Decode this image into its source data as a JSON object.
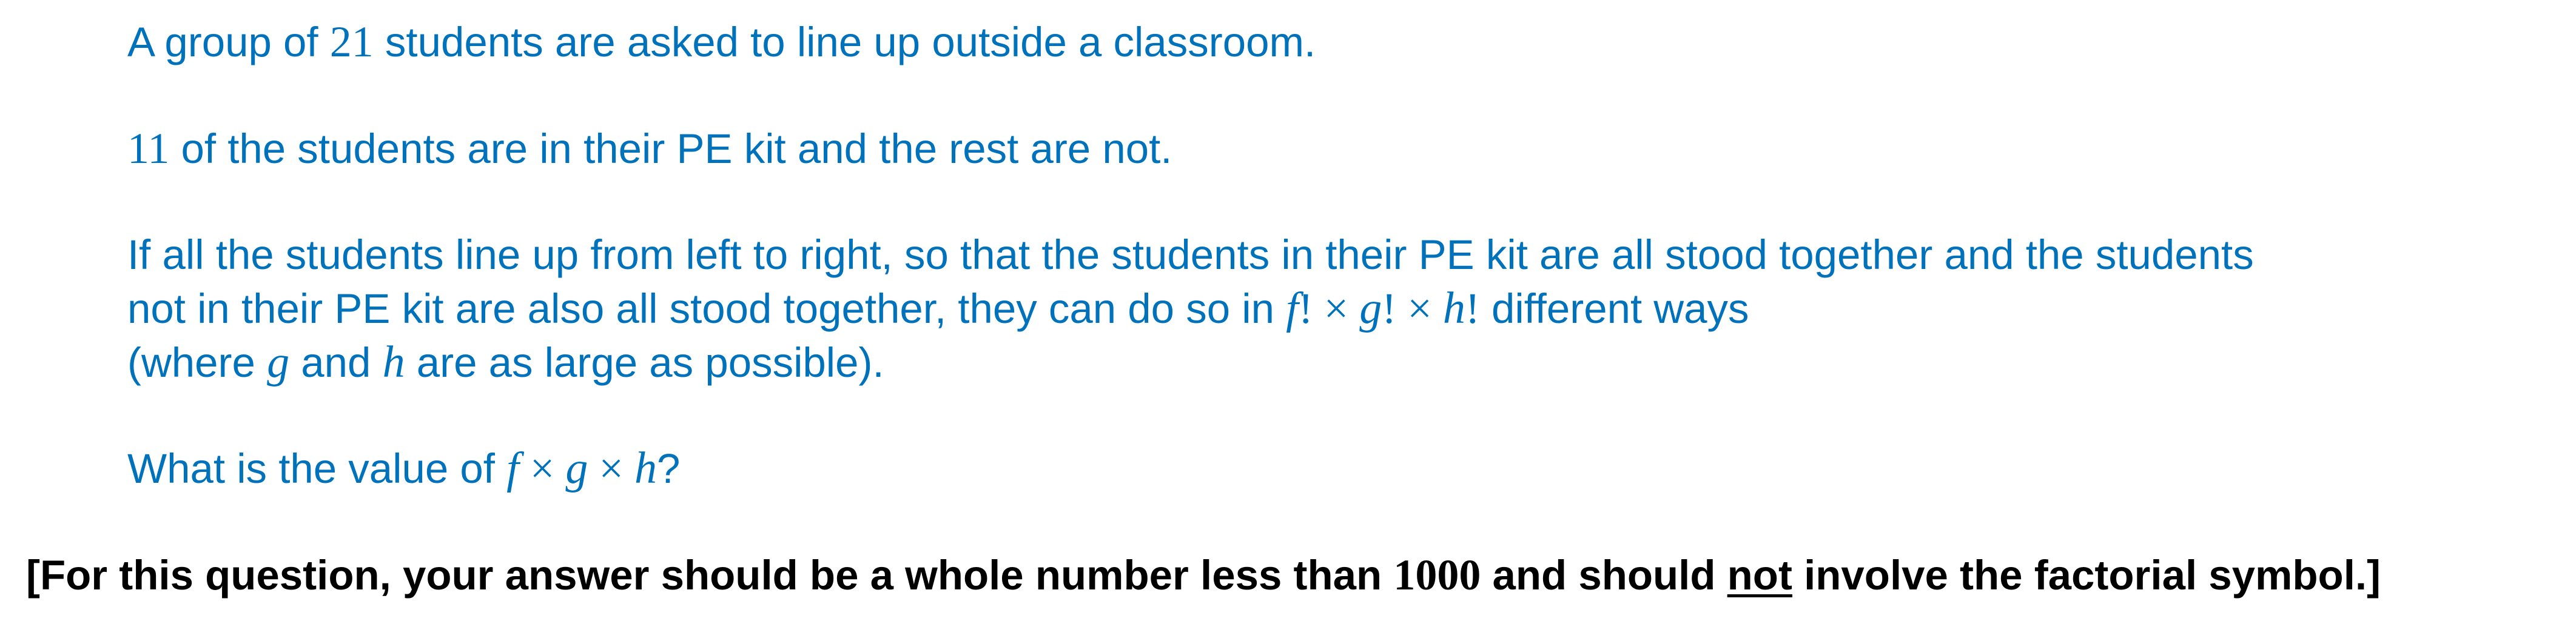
{
  "question": {
    "p1": {
      "a": "A group of ",
      "n": "21",
      "b": " students are asked to line up outside a classroom."
    },
    "p2": {
      "n": "11",
      "b": " of the students are in their PE kit and the rest are not."
    },
    "p3": {
      "line1": "If all the students line up from left to right, so that the students in their PE kit are all stood together and the students",
      "line2_a": "not in their PE kit are also all stood together, they can do so in ",
      "f": "f",
      "fact1": "! × ",
      "g": "g",
      "fact2": "! × ",
      "h": "h",
      "fact3": "!",
      "line2_b": " different ways",
      "line3_a": "(where ",
      "g2": "g",
      "line3_b": " and ",
      "h2": "h",
      "line3_c": " are as large as possible)."
    },
    "p4": {
      "a": "What is the value of ",
      "f": "f",
      "x1": " × ",
      "g": "g",
      "x2": " × ",
      "h": "h",
      "b": "?"
    }
  },
  "instruction": {
    "a": "[For this question, your answer should be a whole number less than ",
    "n": "1000",
    "b": " and should ",
    "u": "not",
    "c": " involve the factorial symbol.]"
  }
}
